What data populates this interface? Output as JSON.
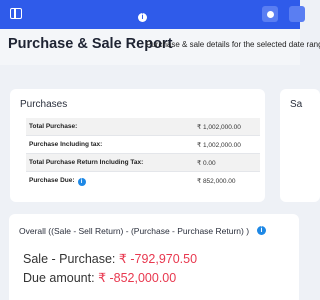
{
  "topbar": {
    "menu_icon": "sidebar-toggle-icon",
    "info_icon": "info-icon",
    "info_glyph": "i",
    "action_icon": "circle-icon",
    "accent": "#2f5bea"
  },
  "header": {
    "title": "Purchase & Sale Report",
    "subtitle": "Purchase & sale details for the selected date range"
  },
  "purchases": {
    "title": "Purchases",
    "rows": [
      {
        "label": "Total Purchase:",
        "value": "₹ 1,002,000.00"
      },
      {
        "label": "Purchase Including tax:",
        "value": "₹ 1,002,000.00"
      },
      {
        "label": "Total Purchase Return Including Tax:",
        "value": "₹ 0.00"
      },
      {
        "label": "Purchase Due:",
        "value": "₹ 852,000.00"
      }
    ],
    "info_glyph": "i"
  },
  "sale": {
    "title": "Sa"
  },
  "overall": {
    "title": "Overall ((Sale - Sell Return) - (Purchase - Purchase Return) )",
    "info_glyph": "i",
    "sale_purchase_label": "Sale - Purchase:",
    "sale_purchase_value": "₹ -792,970.50",
    "due_label": "Due amount:",
    "due_value": "₹ -852,000.00",
    "negative_color": "#e8384f"
  }
}
